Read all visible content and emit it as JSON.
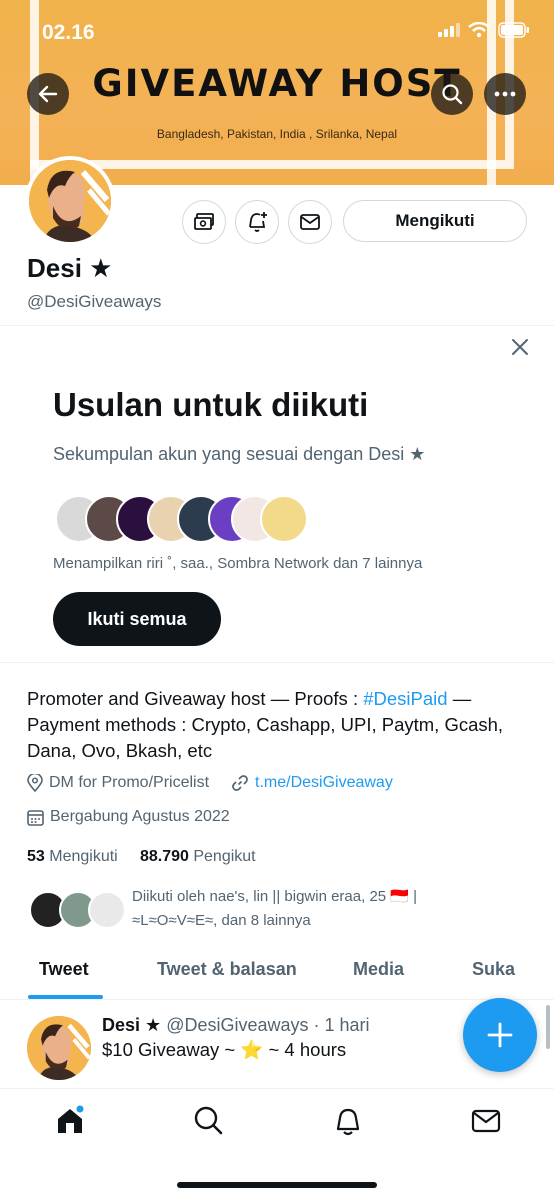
{
  "status_bar": {
    "time": "02.16"
  },
  "banner": {
    "title": "GIVEAWAY HOST",
    "subtitle": "Bangladesh, Pakistan, India , Srilanka, Nepal"
  },
  "profile": {
    "name": "Desi ★",
    "handle": "@DesiGiveaways",
    "follow_button": "Mengikuti"
  },
  "suggestions": {
    "title": "Usulan untuk diikuti",
    "subtitle": "Sekumpulan akun yang sesuai dengan Desi ★",
    "showing": "Menampilkan riri ˚, saa., Sombra Network dan 7 lainnya",
    "follow_all": "Ikuti semua"
  },
  "bio": {
    "line1_a": "Promoter and Giveaway host — Proofs : ",
    "hashtag": "#DesiPaid",
    "line1_b": " —",
    "line2": "Payment methods : Crypto, Cashapp, UPI, Paytm, Gcash,",
    "line3": "Dana, Ovo, Bkash, etc",
    "location": "DM for Promo/Pricelist",
    "url": "t.me/DesiGiveaway",
    "joined": "Bergabung Agustus 2022"
  },
  "stats": {
    "following_count": "53",
    "following_label": "Mengikuti",
    "followers_count": "88.790",
    "followers_label": "Pengikut"
  },
  "followed_by": {
    "line1": "Diikuti oleh nae's, lin || bigwin eraa, 25 🇮🇩 |",
    "line2": "≈L≈O≈V≈E≈, dan 8 lainnya"
  },
  "tabs": [
    "Tweet",
    "Tweet & balasan",
    "Media",
    "Suka"
  ],
  "tweet": {
    "name": "Desi ★",
    "meta": "@DesiGiveaways · 1 hari",
    "text": "$10 Giveaway ~ ⭐ ~ 4 hours"
  },
  "colors": {
    "accent": "#1d9bf0",
    "banner": "#f2b04f",
    "text": "#0f1419",
    "muted": "#536471"
  }
}
